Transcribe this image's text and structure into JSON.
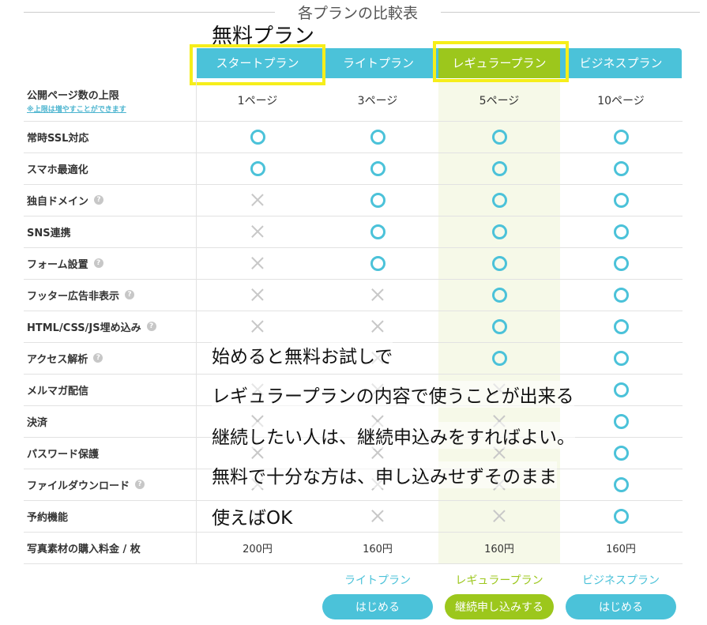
{
  "section_title": "各プランの比較表",
  "free_label": "無料プラン",
  "plans": [
    {
      "name": "スタートプラン",
      "id": "start"
    },
    {
      "name": "ライトプラン",
      "id": "lite"
    },
    {
      "name": "レギュラープラン",
      "id": "regular"
    },
    {
      "name": "ビジネスプラン",
      "id": "business"
    }
  ],
  "rows": [
    {
      "label": "公開ページ数の上限",
      "sub": "※上限は増やすことができます",
      "values": [
        "1ページ",
        "3ページ",
        "5ページ",
        "10ページ"
      ]
    },
    {
      "label": "常時SSL対応",
      "help": false,
      "marks": [
        "o",
        "o",
        "o",
        "o"
      ]
    },
    {
      "label": "スマホ最適化",
      "help": false,
      "marks": [
        "o",
        "o",
        "o",
        "o"
      ]
    },
    {
      "label": "独自ドメイン",
      "help": true,
      "marks": [
        "x",
        "o",
        "o",
        "o"
      ]
    },
    {
      "label": "SNS連携",
      "help": false,
      "marks": [
        "x",
        "o",
        "o",
        "o"
      ]
    },
    {
      "label": "フォーム設置",
      "help": true,
      "marks": [
        "x",
        "o",
        "o",
        "o"
      ]
    },
    {
      "label": "フッター広告非表示",
      "help": true,
      "marks": [
        "x",
        "x",
        "o",
        "o"
      ]
    },
    {
      "label": "HTML/CSS/JS埋め込み",
      "help": true,
      "marks": [
        "x",
        "x",
        "o",
        "o"
      ]
    },
    {
      "label": "アクセス解析",
      "help": true,
      "marks": [
        "x",
        "x",
        "o",
        "o"
      ]
    },
    {
      "label": "メルマガ配信",
      "help": false,
      "marks": [
        "x",
        "x",
        "x",
        "o"
      ]
    },
    {
      "label": "決済",
      "help": false,
      "marks": [
        "x",
        "x",
        "x",
        "o"
      ]
    },
    {
      "label": "パスワード保護",
      "help": false,
      "marks": [
        "x",
        "x",
        "x",
        "o"
      ]
    },
    {
      "label": "ファイルダウンロード",
      "help": true,
      "marks": [
        "x",
        "x",
        "x",
        "o"
      ]
    },
    {
      "label": "予約機能",
      "help": false,
      "marks": [
        "x",
        "x",
        "x",
        "o"
      ]
    },
    {
      "label": "写真素材の購入料金 / 枚",
      "values": [
        "",
        "200円",
        "160円",
        "160円",
        "160円"
      ]
    }
  ],
  "price_values": [
    "200円",
    "160円",
    "160円",
    "160円"
  ],
  "footer": {
    "plans": [
      "ライトプラン",
      "レギュラープラン",
      "ビジネスプラン"
    ],
    "buttons": [
      "はじめる",
      "継続申し込みする",
      "はじめる"
    ]
  },
  "overlay_text": [
    "始めると無料お試しで",
    "レギュラープランの内容で使うことが出来る",
    "継続したい人は、継続申込みをすればよい。",
    "無料で十分な方は、申し込みせずそのまま",
    "使えばOK"
  ],
  "colors": {
    "header_blue": "#4bc2d9",
    "header_green": "#9cc71c",
    "highlight_yellow": "#f6ee1a",
    "regular_column_tint": "#f6f9e8"
  }
}
